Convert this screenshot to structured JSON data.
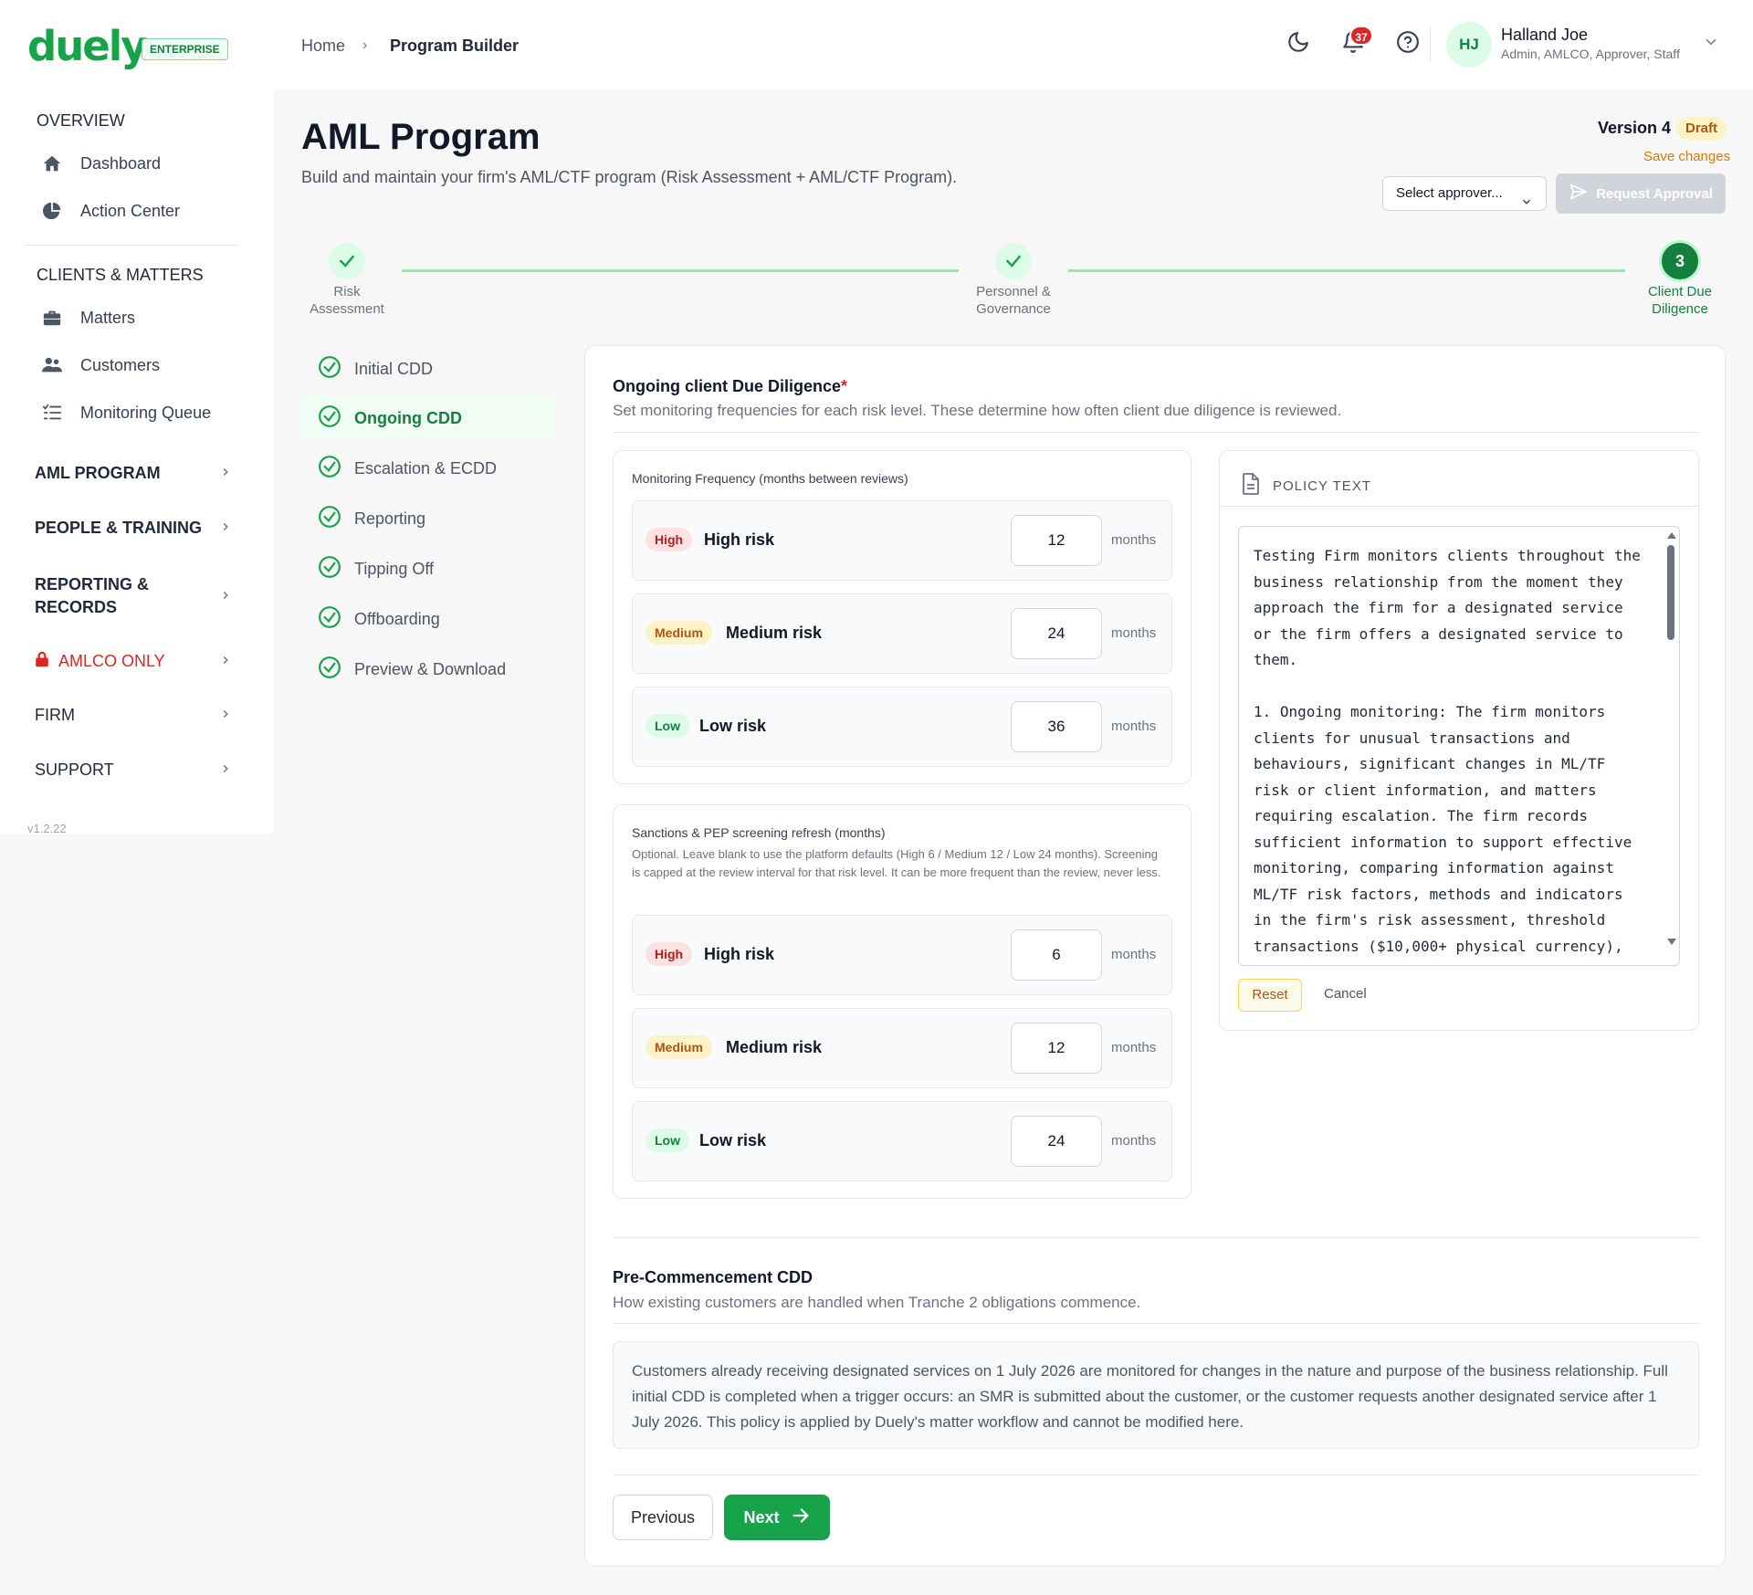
{
  "brand": {
    "logo": "duely",
    "edition": "ENTERPRISE"
  },
  "breadcrumb": {
    "home": "Home",
    "separator": "›",
    "current": "Program Builder"
  },
  "header": {
    "notifications_count": "37",
    "user_initials": "HJ",
    "user_name": "Halland Joe",
    "user_roles": "Admin, AMLCO, Approver, Staff"
  },
  "sidebar": {
    "overview_title": "OVERVIEW",
    "overview_items": [
      {
        "label": "Dashboard",
        "icon": "home-icon"
      },
      {
        "label": "Action Center",
        "icon": "pie-chart-icon"
      }
    ],
    "clients_title": "CLIENTS & MATTERS",
    "clients_items": [
      {
        "label": "Matters",
        "icon": "briefcase-icon"
      },
      {
        "label": "Customers",
        "icon": "users-icon"
      },
      {
        "label": "Monitoring Queue",
        "icon": "list-check-icon"
      }
    ],
    "groups": [
      {
        "label": "AML PROGRAM"
      },
      {
        "label": "PEOPLE & TRAINING"
      },
      {
        "label": "REPORTING &",
        "label2": "RECORDS"
      },
      {
        "label": "AMLCO ONLY",
        "color": "#dc2626"
      },
      {
        "label": "FIRM"
      },
      {
        "label": "SUPPORT"
      }
    ],
    "version": "v1.2.22"
  },
  "page": {
    "title": "AML Program",
    "subtitle": "Build and maintain your firm's AML/CTF program (Risk Assessment + AML/CTF Program).",
    "version_label": "Version 4",
    "status_badge": "Draft",
    "save_changes": "Save changes",
    "approver_placeholder": "Select approver...",
    "request_approval": "Request Approval"
  },
  "stepper": [
    {
      "label": "Risk",
      "label2": "Assessment",
      "state": "done"
    },
    {
      "label": "Personnel &",
      "label2": "Governance",
      "state": "done"
    },
    {
      "label": "Client Due",
      "label2": "Diligence",
      "state": "active",
      "number": "3"
    }
  ],
  "subnav": [
    {
      "label": "Initial CDD"
    },
    {
      "label": "Ongoing CDD",
      "active": true
    },
    {
      "label": "Escalation & ECDD"
    },
    {
      "label": "Reporting"
    },
    {
      "label": "Tipping Off"
    },
    {
      "label": "Offboarding"
    },
    {
      "label": "Preview & Download"
    }
  ],
  "ongoing": {
    "title": "Ongoing client Due Diligence",
    "required_mark": "*",
    "description": "Set monitoring frequencies for each risk level. These determine how often client due diligence is reviewed.",
    "monitoring": {
      "title": "Monitoring Frequency (months between reviews)",
      "rows": [
        {
          "pill": "High",
          "name": "High risk",
          "value": "12",
          "unit": "months"
        },
        {
          "pill": "Medium",
          "name": "Medium risk",
          "value": "24",
          "unit": "months"
        },
        {
          "pill": "Low",
          "name": "Low risk",
          "value": "36",
          "unit": "months"
        }
      ]
    },
    "screening": {
      "title": "Sanctions & PEP screening refresh (months)",
      "note": "Optional. Leave blank to use the platform defaults (High 6 / Medium 12 / Low 24 months). Screening is capped at the review interval for that risk level. It can be more frequent than the review, never less.",
      "rows": [
        {
          "pill": "High",
          "name": "High risk",
          "value": "6",
          "unit": "months"
        },
        {
          "pill": "Medium",
          "name": "Medium risk",
          "value": "12",
          "unit": "months"
        },
        {
          "pill": "Low",
          "name": "Low risk",
          "value": "24",
          "unit": "months"
        }
      ]
    },
    "policy": {
      "title": "POLICY TEXT",
      "text": "Testing Firm monitors clients throughout the\nbusiness relationship from the moment they\napproach the firm for a designated service\nor the firm offers a designated service to\nthem.\n\n1. Ongoing monitoring: The firm monitors\nclients for unusual transactions and\nbehaviours, significant changes in ML/TF\nrisk or client information, and matters\nrequiring escalation. The firm records\nsufficient information to support effective\nmonitoring, comparing information against\nML/TF risk factors, methods and indicators\nin the firm's risk assessment, threshold\ntransactions ($10,000+ physical currency),\nand baseline client behaviour.",
      "reset": "Reset",
      "cancel": "Cancel"
    }
  },
  "pre_commencement": {
    "title": "Pre-Commencement CDD",
    "description": "How existing customers are handled when Tranche 2 obligations commence.",
    "body": "Customers already receiving designated services on 1 July 2026 are monitored for changes in the nature and purpose of the business relationship. Full initial CDD is completed when a trigger occurs: an SMR is submitted about the customer, or the customer requests another designated service after 1 July 2026. This policy is applied by Duely's matter workflow and cannot be modified here."
  },
  "footer_buttons": {
    "previous": "Previous",
    "next": "Next"
  },
  "colors": {
    "brand": "#16a34a",
    "warning": "#d97706",
    "danger": "#dc2626"
  }
}
